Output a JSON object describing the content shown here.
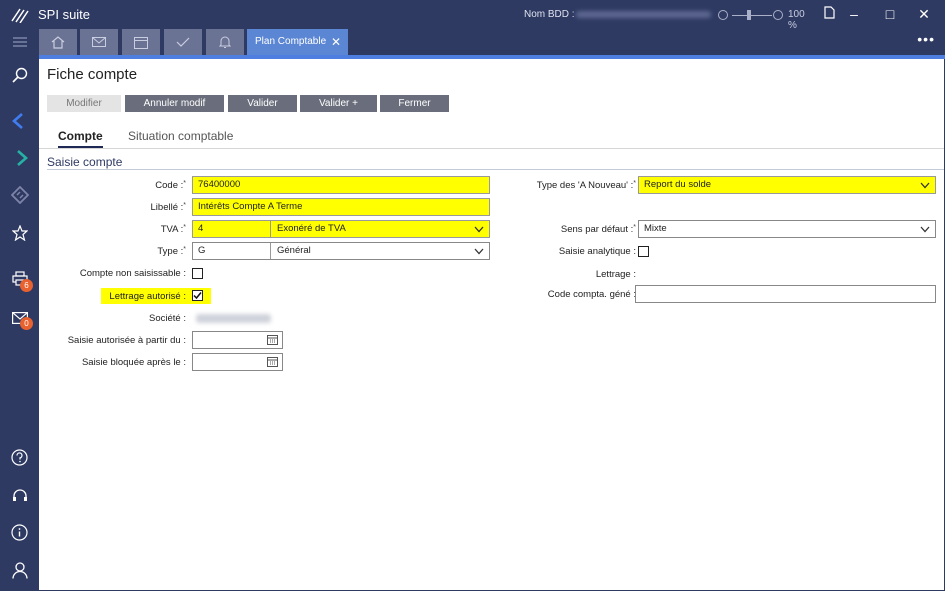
{
  "app": {
    "title": "SPI suite",
    "db_label": "Nom BDD :",
    "zoom": "100 %",
    "tab_label": "Plan Comptable",
    "badge_print": "6",
    "badge_mail": "0"
  },
  "page": {
    "title": "Fiche compte",
    "buttons": {
      "modifier": "Modifier",
      "annuler": "Annuler modif",
      "valider": "Valider",
      "valider_plus": "Valider +",
      "fermer": "Fermer"
    },
    "tabs": {
      "compte": "Compte",
      "situation": "Situation comptable"
    },
    "section": "Saisie compte"
  },
  "form": {
    "code_label": "Code :",
    "code_value": "76400000",
    "libelle_label": "Libellé :",
    "libelle_value": "Intérêts Compte A Terme",
    "tva_label": "TVA :",
    "tva_code": "4",
    "tva_text": "Exonéré de TVA",
    "type_label": "Type :",
    "type_code": "G",
    "type_text": "Général",
    "non_saisissable_label": "Compte non saisissable :",
    "lettrage_autorise_label": "Lettrage autorisé :",
    "lettrage_autorise_checked": true,
    "societe_label": "Société :",
    "saisie_auto_label": "Saisie autorisée à partir du :",
    "saisie_bloquee_label": "Saisie bloquée après le :",
    "type_an_label": "Type des 'A Nouveau' :",
    "type_an_value": "Report du solde",
    "sens_label": "Sens par défaut :",
    "sens_value": "Mixte",
    "analytique_label": "Saisie analytique :",
    "lettrage_label": "Lettrage :",
    "code_compta_label": "Code compta. géné :"
  },
  "colors": {
    "chrome": "#2f3a63",
    "accent": "#4d7ee0",
    "highlight": "#ffff00",
    "badge": "#e8622f"
  }
}
